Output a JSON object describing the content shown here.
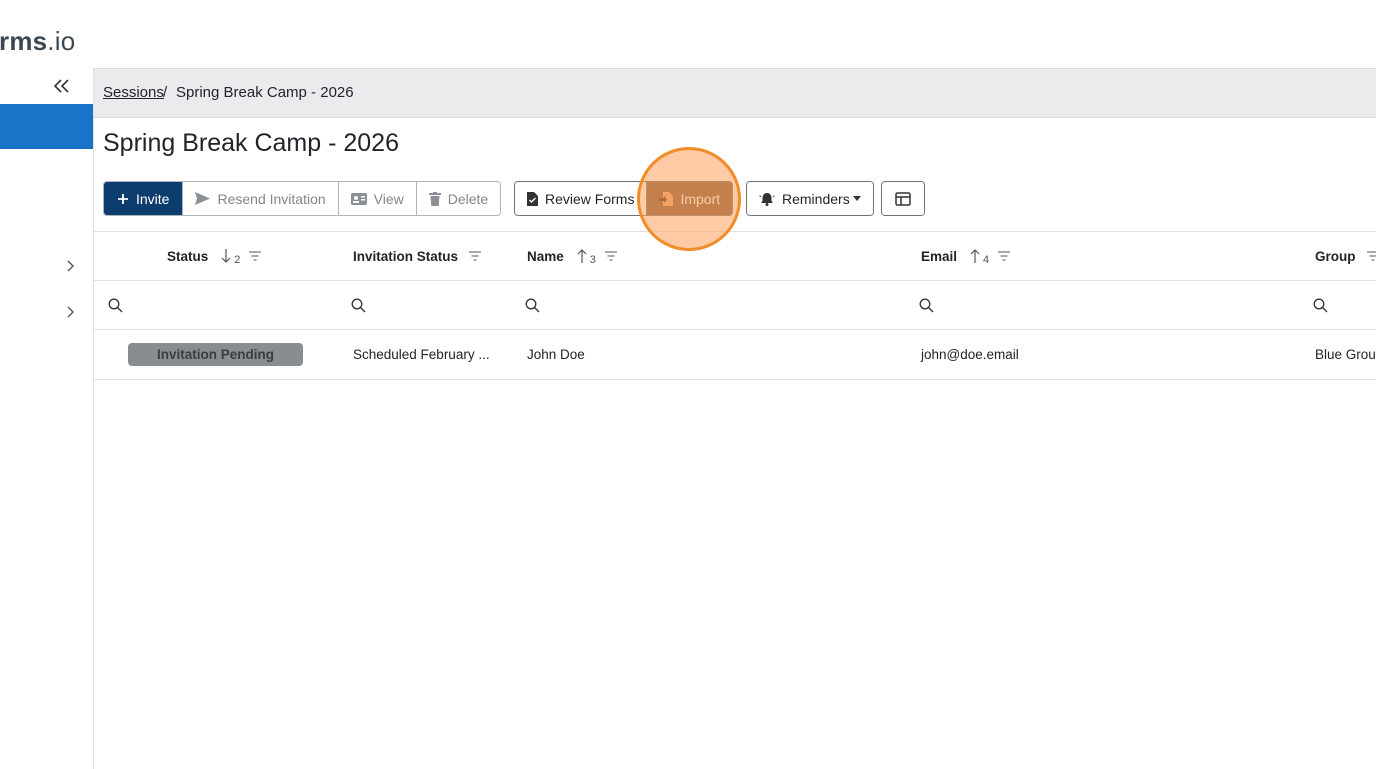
{
  "app": {
    "logo_bold": "rms",
    "logo_light": ".io"
  },
  "breadcrumb": {
    "parent": "Sessions",
    "separator": "/",
    "current": "Spring Break Camp - 2026"
  },
  "page": {
    "title": "Spring Break Camp - 2026"
  },
  "toolbar": {
    "invite": "Invite",
    "resend": "Resend Invitation",
    "view": "View",
    "delete": "Delete",
    "review_forms": "Review Forms",
    "import": "Import",
    "reminders": "Reminders"
  },
  "table": {
    "columns": [
      {
        "label": "Status",
        "sort": "desc",
        "sort_order": "2"
      },
      {
        "label": "Invitation Status",
        "sort": "",
        "sort_order": ""
      },
      {
        "label": "Name",
        "sort": "asc",
        "sort_order": "3"
      },
      {
        "label": "Email",
        "sort": "asc",
        "sort_order": "4"
      },
      {
        "label": "Group",
        "sort": "",
        "sort_order": ""
      }
    ],
    "rows": [
      {
        "status": "Invitation Pending",
        "invitation_status": "Scheduled February ...",
        "name": "John Doe",
        "email": "john@doe.email",
        "group": "Blue Grou"
      }
    ]
  },
  "colors": {
    "primary": "#0d3c6e",
    "sidebar_active": "#1a73c8",
    "import_highlight": "#7a5a3d",
    "cursor_ring": "#f28c2b"
  }
}
